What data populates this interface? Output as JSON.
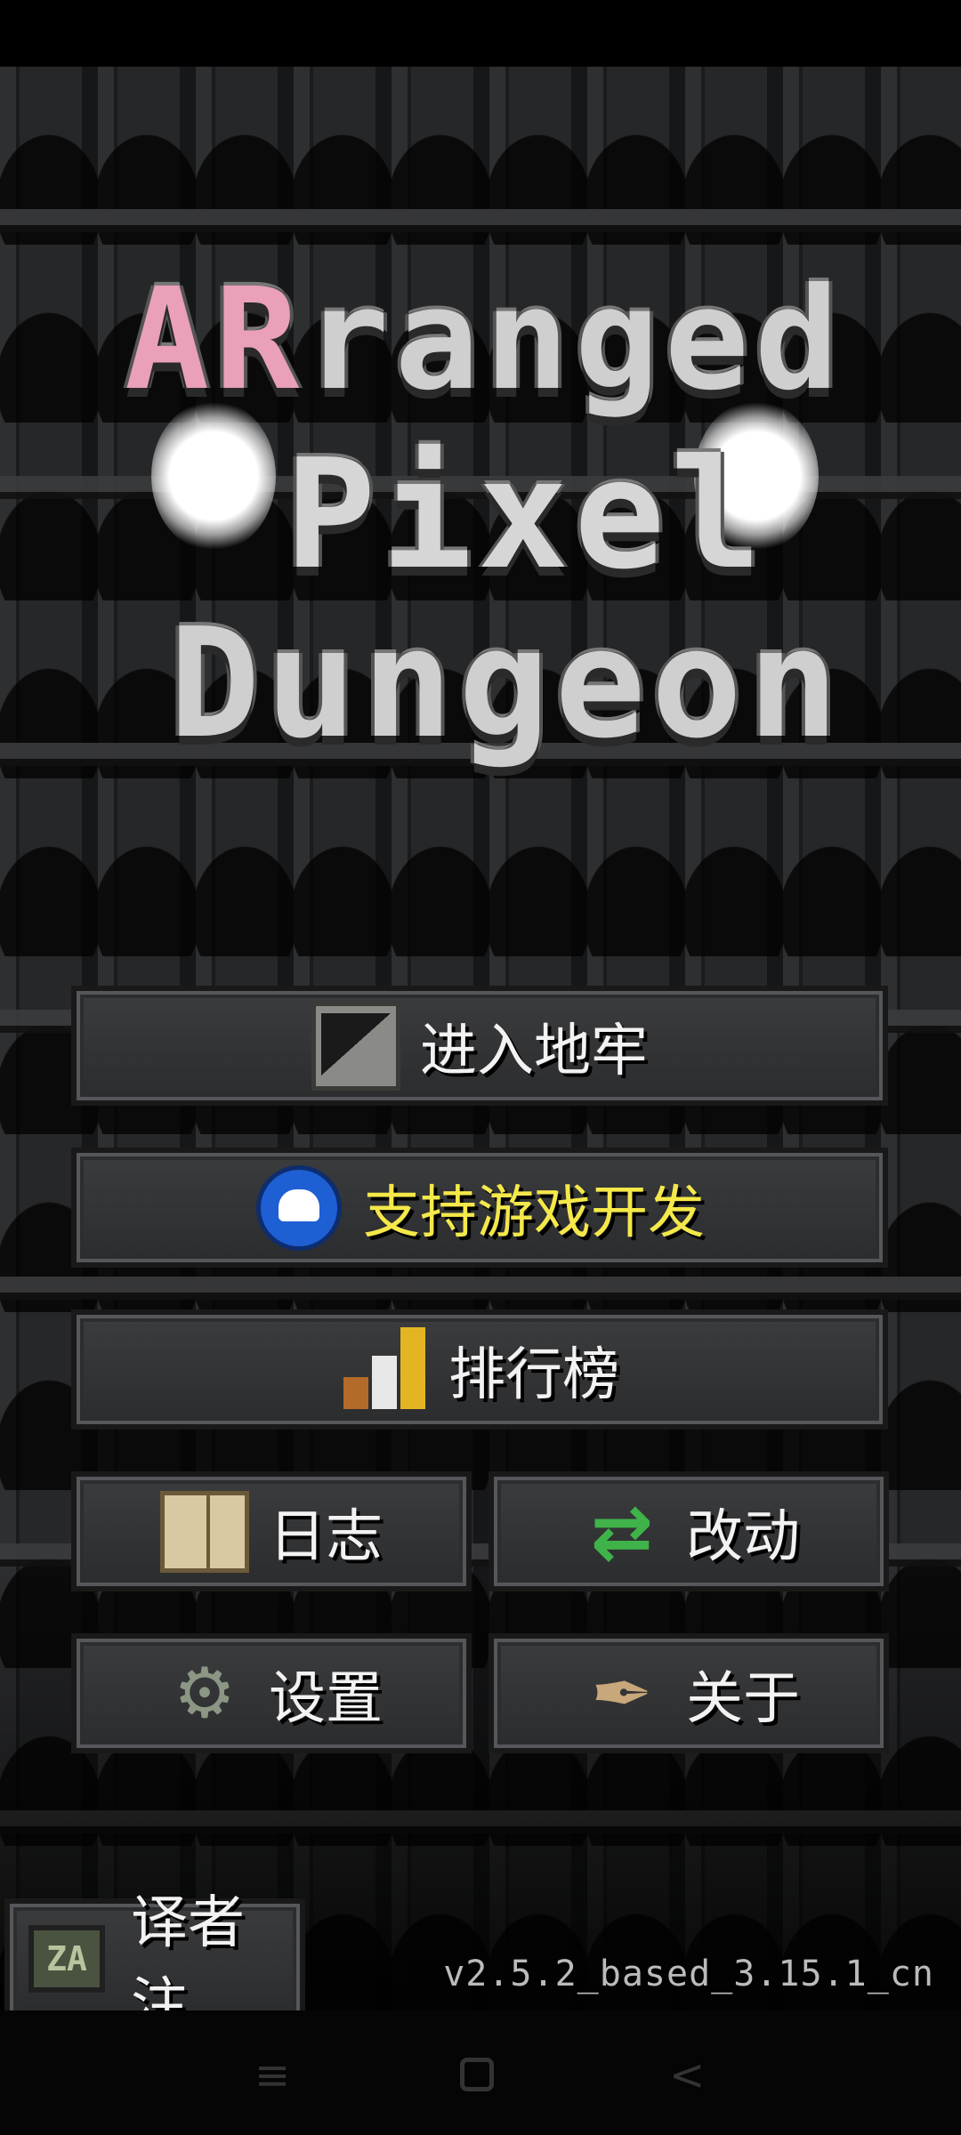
{
  "logo": {
    "line1_pink": "AR",
    "line1_rest": "ranged",
    "line2": "Pixel",
    "line3": "Dungeon"
  },
  "menu": {
    "enter_dungeon": "进入地牢",
    "support": "支持游戏开发",
    "rankings": "排行榜",
    "journal": "日志",
    "changes": "改动",
    "settings": "设置",
    "about": "关于"
  },
  "translator": {
    "icon_text": "ZA",
    "label": "译者注"
  },
  "version": "v2.5.2_based_3.15.1_cn",
  "navbar": {
    "menu_glyph": "≡",
    "home_glyph": "□",
    "back_glyph": "<"
  },
  "icons": {
    "enter": "stairs-icon",
    "support": "ghost-icon",
    "rankings": "bar-chart-icon",
    "journal": "book-icon",
    "changes": "swap-arrows-icon",
    "settings": "gears-icon",
    "about": "quill-icon",
    "translator": "keyboard-icon"
  },
  "colors": {
    "support_label": "#f4e84a",
    "logo_pink": "#e9a0b8"
  }
}
